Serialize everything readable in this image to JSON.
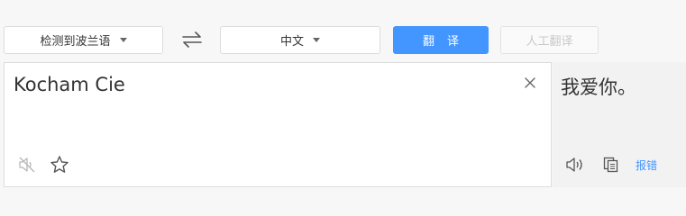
{
  "toolbar": {
    "source_language": "检测到波兰语",
    "target_language": "中文",
    "translate_label": "翻译",
    "human_translate_label": "人工翻译"
  },
  "source": {
    "text": "Kocham Cie"
  },
  "target": {
    "text": "我爱你。",
    "report_label": "报错"
  },
  "icons": {
    "swap": "swap-arrows-icon",
    "clear": "close-icon",
    "sound_off": "speaker-muted-icon",
    "favorite": "star-icon",
    "sound": "speaker-icon",
    "copy": "copy-icon"
  },
  "colors": {
    "accent": "#4395ff",
    "panel_bg": "#f2f2f2",
    "border": "#dcdcdc"
  }
}
